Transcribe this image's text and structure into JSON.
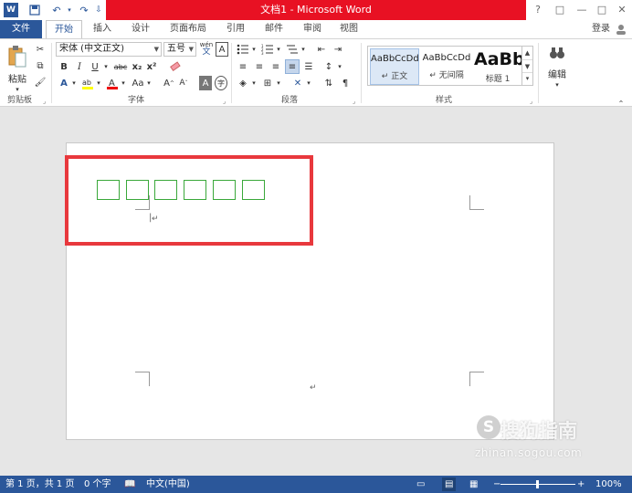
{
  "window": {
    "title": "文档1 - Microsoft Word",
    "app_icon": "W",
    "controls": {
      "help": "?",
      "restore": "□",
      "minimize": "—",
      "maximize": "□",
      "close": "✕"
    }
  },
  "quick_access": {
    "save": "save-icon",
    "undo": "undo-icon",
    "redo": "redo-icon",
    "customize": "customize-icon"
  },
  "tabs": [
    {
      "label": "文件"
    },
    {
      "label": "开始"
    },
    {
      "label": "插入"
    },
    {
      "label": "设计"
    },
    {
      "label": "页面布局"
    },
    {
      "label": "引用"
    },
    {
      "label": "邮件"
    },
    {
      "label": "审阅"
    },
    {
      "label": "视图"
    }
  ],
  "sign_in": "登录",
  "ribbon": {
    "clipboard": {
      "paste_label": "粘贴",
      "group_label": "剪贴板"
    },
    "font": {
      "font_name": "宋体 (中文正文)",
      "font_size": "五号",
      "pinyin": "wén",
      "group_label": "字体",
      "bold": "B",
      "italic": "I",
      "underline": "U",
      "strike": "abc",
      "subscript": "x₂",
      "superscript": "x²",
      "case": "Aa",
      "grow": "A",
      "shrink": "A",
      "char_border": "A"
    },
    "paragraph": {
      "group_label": "段落"
    },
    "styles": {
      "group_label": "样式",
      "items": [
        {
          "sample": "AaBbCcDd",
          "name": "↵ 正文"
        },
        {
          "sample": "AaBbCcDd",
          "name": "↵ 无间隔"
        },
        {
          "sample": "AaBb",
          "name": "标题 1"
        }
      ]
    },
    "editing": {
      "label": "编辑"
    }
  },
  "document": {
    "boxes": 6,
    "para_mark": "↵"
  },
  "status": {
    "page": "第 1 页，共 1 页",
    "words": "0 个字",
    "language": "中文(中国)",
    "zoom": "100%"
  },
  "watermark": {
    "brand": "搜狗指南",
    "url": "zhinan.sogou.com",
    "logo": "S"
  },
  "colors": {
    "accent": "#2b579a",
    "title_highlight": "#e81123",
    "annotation": "#e8383d",
    "box_border": "#3aa83a"
  }
}
